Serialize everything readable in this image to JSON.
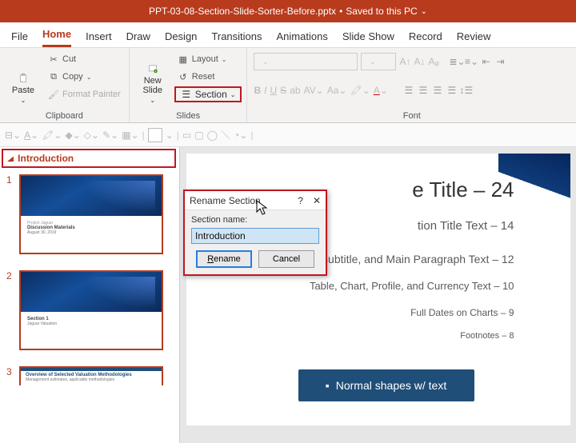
{
  "titlebar": {
    "filename": "PPT-03-08-Section-Slide-Sorter-Before.pptx",
    "saved_status": "Saved to this PC"
  },
  "ribbon": {
    "tabs": [
      "File",
      "Home",
      "Insert",
      "Draw",
      "Design",
      "Transitions",
      "Animations",
      "Slide Show",
      "Record",
      "Review"
    ],
    "active_tab": "Home",
    "clipboard": {
      "paste": "Paste",
      "cut": "Cut",
      "copy": "Copy",
      "format_painter": "Format Painter",
      "label": "Clipboard"
    },
    "slides": {
      "new_slide": "New\nSlide",
      "layout": "Layout",
      "reset": "Reset",
      "section": "Section",
      "label": "Slides"
    },
    "font": {
      "label": "Font"
    }
  },
  "thumb_pane": {
    "section_name": "Introduction",
    "slides": [
      {
        "num": "1",
        "title": "Discussion Materials",
        "sub": "August 30, 2019"
      },
      {
        "num": "2",
        "title": "Section 1",
        "sub": "Jaguar Valuation"
      },
      {
        "num": "3",
        "title": "Overview of Selected Valuation Methodologies",
        "sub": "Management estimates, applicable methodologies"
      }
    ]
  },
  "dialog": {
    "title": "Rename Section",
    "help": "?",
    "close": "✕",
    "field_label": "Section name:",
    "value": "Introduction",
    "rename": "Rename",
    "cancel": "Cancel"
  },
  "slide_content": {
    "l1": "e Title – 24",
    "l2": "tion Title Text – 14",
    "l3": "Bullet, Subtitle, and Main Paragraph Text – 12",
    "l4": "Table, Chart, Profile, and Currency Text – 10",
    "l5": "Full Dates on Charts – 9",
    "l6": "Footnotes – 8",
    "shape_label": "Normal shapes w/ text"
  }
}
